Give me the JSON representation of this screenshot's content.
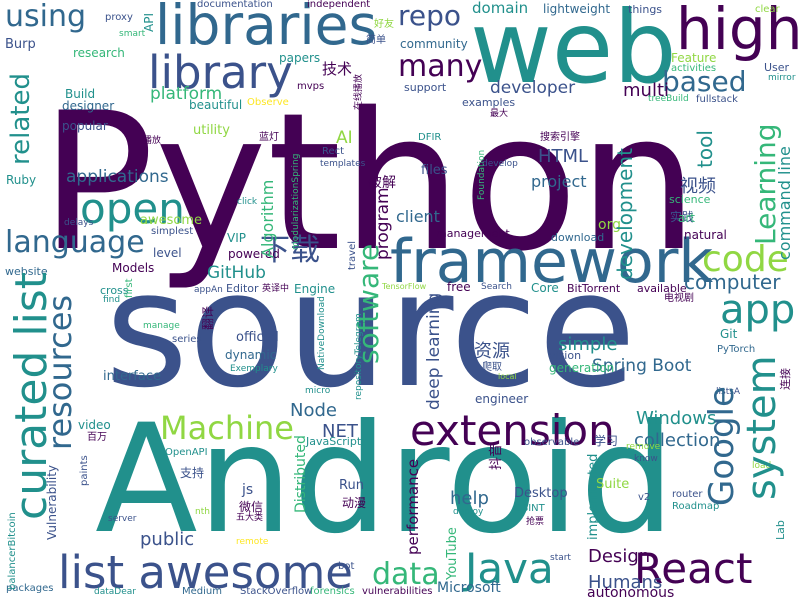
{
  "palette": {
    "purple_dark": "#440154",
    "indigo": "#3b528b",
    "blue": "#31688e",
    "teal": "#21908c",
    "green": "#35b779",
    "lime": "#90d743",
    "yellow": "#fde725",
    "background": "#ffffff"
  },
  "words": [
    "Python",
    "source",
    "Android",
    "web",
    "framework",
    "libraries",
    "curated list",
    "list awesome",
    "high",
    "library",
    "extension",
    "system",
    "Google",
    "React",
    "Java",
    "app",
    "open",
    "code",
    "language",
    "resources",
    "related",
    "Machine",
    "many",
    "based",
    "using",
    "repo",
    "software",
    "data",
    "下载",
    "Learning",
    "development",
    "tool",
    "command line",
    "computer",
    "HTML",
    "program",
    "Design",
    "Humans",
    "Windows",
    "collection",
    "deep learning",
    "资源",
    "simple",
    "Spring Boot",
    "Node",
    "NET",
    "help",
    "public",
    "GitHub",
    "Algorithm",
    "视频",
    "multi",
    "developer",
    "applications",
    "domain",
    "lightweight",
    "things",
    "clear",
    "documentation",
    "independent",
    "proxy",
    "smart",
    "API",
    "Burp",
    "research",
    "papers",
    "community",
    "技术",
    "mvps",
    "support",
    "examples",
    "最大",
    "Feature",
    "activities",
    "User",
    "mirror",
    "Build",
    "designer",
    "platform",
    "beautiful",
    "Observe",
    "treeBuild",
    "fullstack",
    "popular",
    "utility",
    "AI",
    "蓝灯",
    "Rect",
    "templates",
    "files",
    "搜索引擎",
    "develop",
    "DFIR",
    "Foundation",
    "science",
    "实践",
    "art",
    "Ruby",
    "破解",
    "project",
    "client",
    "org",
    "awesome",
    "simplest",
    "VIP",
    "level",
    "Models",
    "Editor",
    "英译中",
    "Engine",
    "free",
    "Search",
    "Core",
    "BitTorrent",
    "available",
    "电视剧",
    "Git",
    "PyTorch",
    "Lab",
    "vision",
    "generation",
    "爬取",
    "engineer",
    "local",
    "listsA",
    "performance",
    "Desktop",
    "Suite",
    "Roadmap",
    "OSINT",
    "抢票",
    "学习",
    "抖音",
    "implemented",
    "YouTube",
    "Microsoft",
    "autonomous",
    "start",
    "v2",
    "router",
    "know",
    "remove",
    "load",
    "observable",
    "vulnerabilities",
    "forensics",
    "bot",
    "StackOverflow",
    "Medium",
    "dataDear",
    "packages",
    "balancerBitcoin",
    "Vulnerability",
    "video",
    "百万",
    "OpenAPI",
    "支持",
    "paints",
    "server",
    "nth",
    "五大类",
    "remote",
    "Distributed",
    "js",
    "微信",
    "Run",
    "动漫",
    "deploy",
    "JavaScript",
    "official",
    "dynamic",
    "Exemplary",
    "micro",
    "interface",
    "series",
    "manage",
    "appAn",
    "翻译",
    "cross",
    "find",
    "first",
    "travel",
    "TensorFlow",
    "NativeDownload",
    "repositoryTelegram",
    "modularizationSpring",
    "click",
    "powered",
    "delays",
    "website",
    "download",
    "management",
    "natural",
    "好友",
    "简单",
    "在线播放",
    "播放",
    "连接",
    "小程序",
    "图片",
    "可视化",
    "Exemplary",
    "Observe"
  ]
}
